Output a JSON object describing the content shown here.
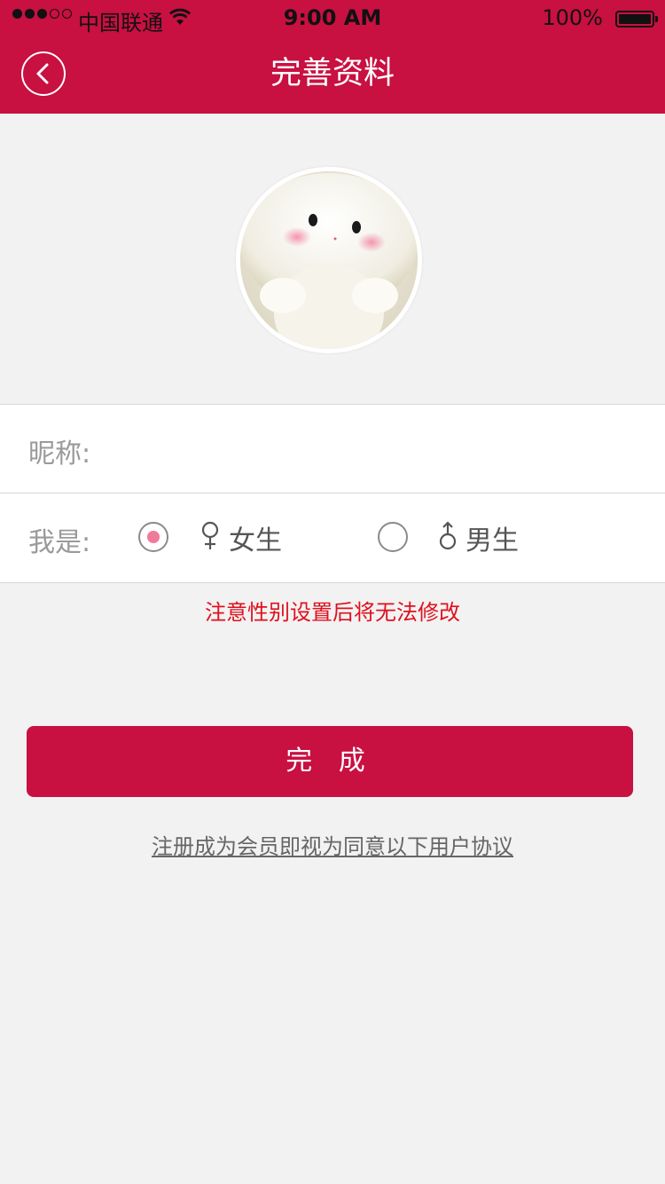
{
  "status_bar": {
    "carrier": "中国联通",
    "time": "9:00 AM",
    "battery": "100%",
    "signal_icon": "signal-dots-icon",
    "wifi_icon": "wifi-icon",
    "battery_icon": "battery-icon"
  },
  "header": {
    "title": "完善资料",
    "back_icon": "chevron-left-icon"
  },
  "form": {
    "nickname_label": "昵称:",
    "nickname_value": "",
    "gender_label": "我是:",
    "female_label": "女生",
    "male_label": "男生",
    "selected_gender": "female"
  },
  "notice": "注意性别设置后将无法修改",
  "done_label": "完 成",
  "agreement_text": "注册成为会员即视为同意以下用户协议",
  "colors": {
    "brand": "#c81041",
    "notice": "#e0101e",
    "radio_selected": "#f07a9a"
  }
}
